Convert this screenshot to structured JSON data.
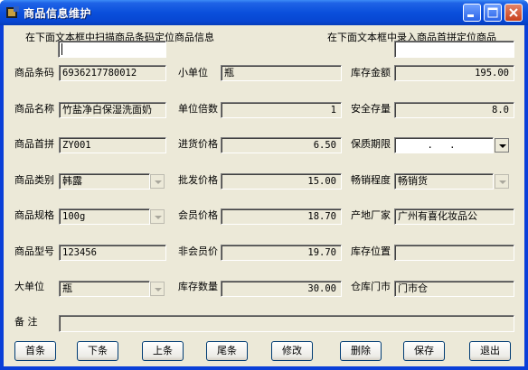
{
  "window": {
    "title": "商品信息维护"
  },
  "search": {
    "barcode_prompt": "在下面文本框中扫描商品条码定位商品信息",
    "pinyin_prompt": "在下面文本框中录入商品首拼定位商品",
    "barcode_value": "",
    "pinyin_value": ""
  },
  "fields": {
    "barcode": {
      "label": "商品条码",
      "value": "6936217780012"
    },
    "name": {
      "label": "商品名称",
      "value": "竹盐净白保湿洗面奶"
    },
    "pinyin": {
      "label": "商品首拼",
      "value": "ZY001"
    },
    "category": {
      "label": "商品类别",
      "value": "韩露"
    },
    "spec": {
      "label": "商品规格",
      "value": "100g"
    },
    "model": {
      "label": "商品型号",
      "value": "123456"
    },
    "big_unit": {
      "label": "大单位",
      "value": "瓶"
    },
    "small_unit": {
      "label": "小单位",
      "value": "瓶"
    },
    "unit_multiple": {
      "label": "单位倍数",
      "value": "1"
    },
    "purchase_price": {
      "label": "进货价格",
      "value": "6.50"
    },
    "wholesale_price": {
      "label": "批发价格",
      "value": "15.00"
    },
    "member_price": {
      "label": "会员价格",
      "value": "18.70"
    },
    "nonmember_price": {
      "label": "非会员价",
      "value": "19.70"
    },
    "stock_qty": {
      "label": "库存数量",
      "value": "30.00"
    },
    "stock_amount": {
      "label": "库存金额",
      "value": "195.00"
    },
    "safety_stock": {
      "label": "安全存量",
      "value": "8.0"
    },
    "expiry": {
      "label": "保质期限",
      "value": ". ."
    },
    "sales_level": {
      "label": "畅销程度",
      "value": "畅销货"
    },
    "manufacturer": {
      "label": "产地厂家",
      "value": "广州有喜化妆品公"
    },
    "stock_location": {
      "label": "库存位置",
      "value": ""
    },
    "warehouse": {
      "label": "仓库门市",
      "value": "门市仓"
    },
    "remark": {
      "label": "备 注",
      "value": ""
    }
  },
  "buttons": {
    "first": "首条",
    "next": "下条",
    "prev": "上条",
    "last": "尾条",
    "edit": "修改",
    "delete": "删除",
    "save": "保存",
    "exit": "退出"
  },
  "colors": {
    "titlebar": "#0a4fdc",
    "client": "#ece9d8",
    "border": "#003c74"
  }
}
